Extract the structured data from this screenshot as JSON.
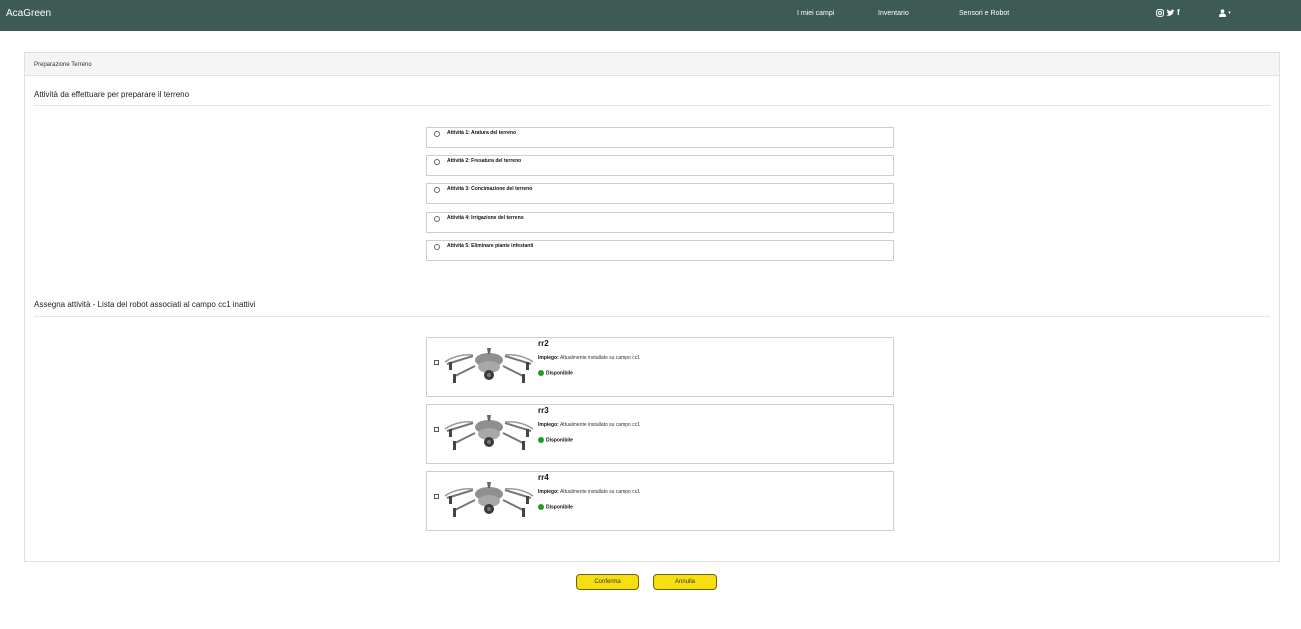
{
  "navbar": {
    "brand": "AcaGreen",
    "links": [
      "I miei campi",
      "Inventario",
      "Sensori e Robot"
    ],
    "icons": [
      "instagram-icon",
      "twitter-icon",
      "facebook-icon",
      "user-icon"
    ],
    "facebook_glyph": "f",
    "user_caret": "▾"
  },
  "panel": {
    "header": "Preparazione Terreno",
    "activities_title": "Attività da effettuare per preparare il terreno",
    "activities": [
      "Attività 1: Aratura del terreno",
      "Attività 2: Fresatura del terreno",
      "Attività 3: Concimazione del terreno",
      "Attività 4: Irrigazione del terreno",
      "Attività 5: Eliminare piante infestanti"
    ],
    "robots_title": "Assegna attività - Lista dei robot associati al campo cc1 inattivi",
    "robots": [
      {
        "name": "rr2",
        "usage_label": "Impiego:",
        "usage": "Attualmente installato su campo cc1",
        "status": "Disponibile"
      },
      {
        "name": "rr3",
        "usage_label": "Impiego:",
        "usage": "Attualmente installato su campo cc1",
        "status": "Disponibile"
      },
      {
        "name": "rr4",
        "usage_label": "Impiego:",
        "usage": "Attualmente installato su campo cc1",
        "status": "Disponibile"
      }
    ]
  },
  "buttons": {
    "confirm": "Conferma",
    "cancel": "Annulla"
  },
  "colors": {
    "navbar": "#3d5a55",
    "button": "#f7de10",
    "status_ok": "#19a025"
  }
}
